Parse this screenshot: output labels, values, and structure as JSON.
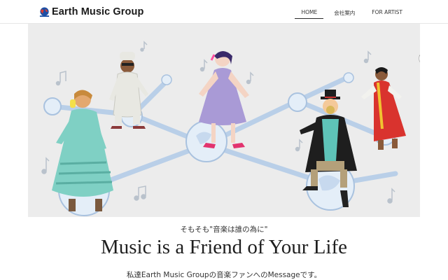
{
  "header": {
    "brand_name": "Earth Music Group",
    "nav": [
      {
        "label": "HOME",
        "active": true
      },
      {
        "label": "会社案内",
        "active": false
      },
      {
        "label": "FOR ARTIST",
        "active": false
      }
    ]
  },
  "hero": {
    "scroll_icon": "chevron-up-icon",
    "illustration_icons": [
      "globe-icon",
      "music-note-icon"
    ]
  },
  "content": {
    "subtitle": "そもそも\"音楽は誰の為に\"",
    "title": "Music is a Friend of Your Life",
    "message": "私達Earth Music Groupの音楽ファンへのMessageです。"
  },
  "colors": {
    "hero_bg": "#ececec",
    "link_lines": "#b9cfe8",
    "globe": "#e4eef8"
  }
}
